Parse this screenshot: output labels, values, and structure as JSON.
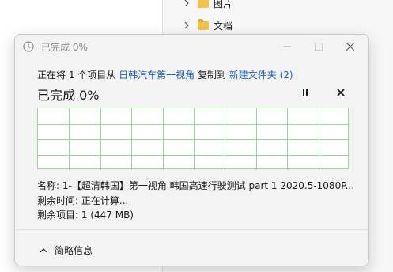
{
  "explorer": {
    "items": [
      {
        "label": "图片",
        "icon": "folder-icon"
      },
      {
        "label": "文档",
        "icon": "folder-icon"
      }
    ]
  },
  "dialog": {
    "title": "已完成 0%",
    "copy_prefix": "正在将 1 个项目从",
    "source": "日韩汽车第一视角",
    "copy_middle": "复制到",
    "destination": "新建文件夹 (2)",
    "status": "已完成 0%",
    "progress_percent": 0,
    "name_label": "名称:",
    "name_value": "1-【超清韩国】第一视角 韩国高速行驶测试 part 1 2020.5-1080P...",
    "time_label": "剩余时间:",
    "time_value": "正在计算...",
    "items_label": "剩余项目:",
    "items_value": "1 (447 MB)",
    "details_label": "简略信息"
  },
  "colors": {
    "link": "#1d5fb8",
    "graph_grid": "#9ad59a",
    "folder": "#f2c14e"
  }
}
